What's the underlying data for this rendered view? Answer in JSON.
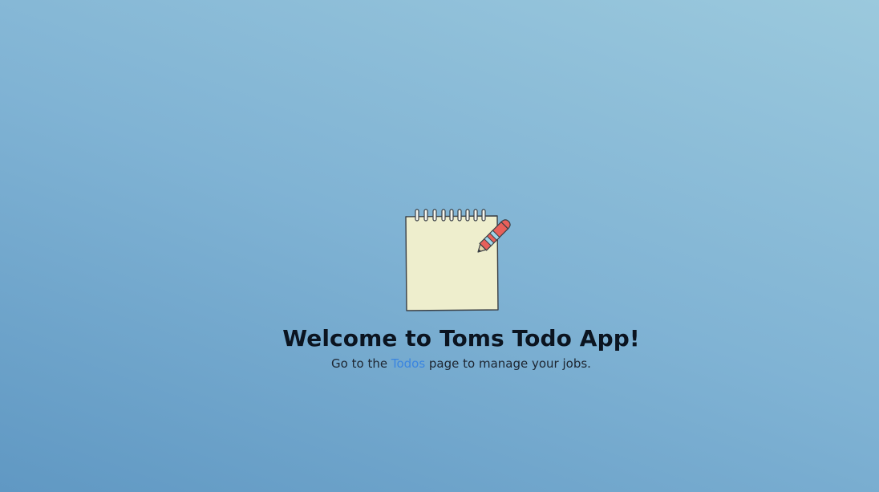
{
  "hero": {
    "logo_icon": "notepad-with-pencil-icon",
    "title": "Welcome to Toms Todo App!",
    "subtitle_before": "Go to the ",
    "subtitle_link": "Todos",
    "subtitle_after": " page to manage your jobs."
  },
  "colors": {
    "background_start": "#6098c3",
    "background_end": "#9bc9dd",
    "link": "#3a85e0",
    "paper": "#eeeecd",
    "pencil_body": "#e8605a",
    "pencil_stripe": "#9fd4e8"
  }
}
